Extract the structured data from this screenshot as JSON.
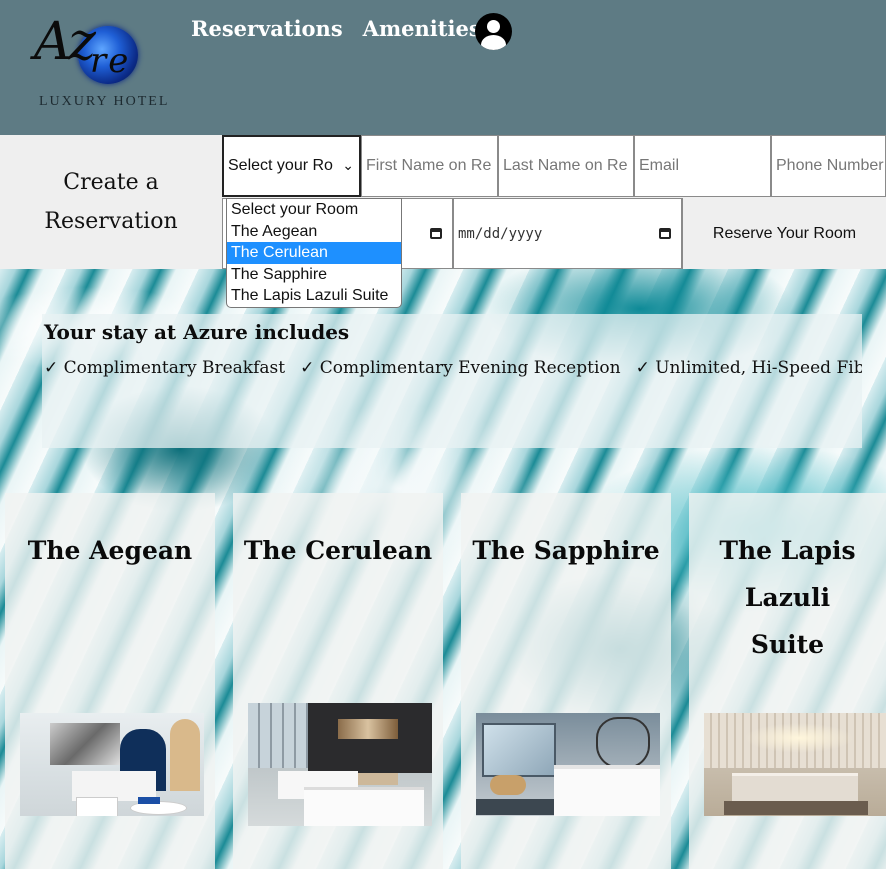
{
  "logo": {
    "script_text_1": "Az",
    "script_text_2": "re",
    "subtitle": "LUXURY HOTEL"
  },
  "nav": {
    "reservations": "Reservations",
    "amenities": "Amenities",
    "account_icon": "user-circle-icon"
  },
  "reservation": {
    "title": "Create a Reservation",
    "room_select_value": "Select your Ro",
    "first_name_placeholder": "First Name on Re",
    "last_name_placeholder": "Last Name on Re",
    "email_placeholder": "Email",
    "phone_placeholder": "Phone Number",
    "date_placeholder": "mm/dd/yyyy",
    "reserve_button": "Reserve Your Room",
    "dropdown_options": [
      "Select your Room",
      "The Aegean",
      "The Cerulean",
      "The Sapphire",
      "The Lapis Lazuli Suite"
    ],
    "highlighted_option": "The Cerulean"
  },
  "includes": {
    "heading": "Your stay at Azure includes",
    "perks": [
      "✓ Complimentary Breakfast",
      "✓ Complimentary Evening Reception",
      "✓ Unlimited, Hi-Speed Fibe"
    ]
  },
  "rooms": [
    {
      "name": "The Aegean"
    },
    {
      "name": "The Cerulean"
    },
    {
      "name": "The Sapphire"
    },
    {
      "name": "The Lapis Lazuli Suite"
    }
  ],
  "colors": {
    "header_bg": "#5e7b84",
    "reservation_bg": "#efefef",
    "dropdown_highlight": "#1e90ff"
  }
}
